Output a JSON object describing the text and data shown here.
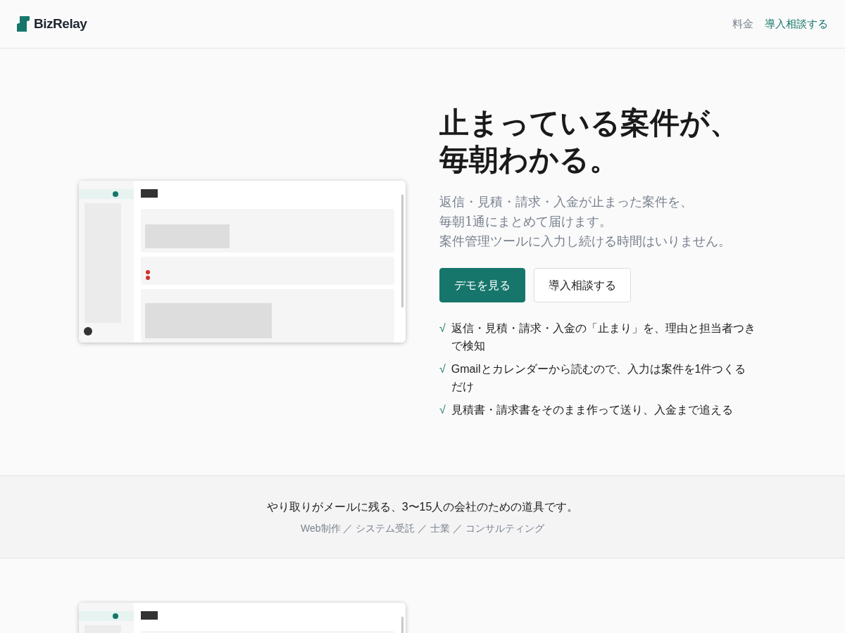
{
  "header": {
    "brand": "BizRelay",
    "nav": [
      {
        "label": "料金",
        "kind": "plain"
      },
      {
        "label": "導入相談する",
        "kind": "accent"
      }
    ]
  },
  "hero": {
    "preview": {
      "kind": "picture"
    },
    "title_lines": [
      "止まっている案件が、",
      "毎朝わかる。"
    ],
    "subtitle_lines": [
      "返信・見積・請求・入金が止まった案件を、",
      "毎朝1通にまとめて届けます。",
      "案件管理ツールに入力し続ける時間はいりません。"
    ],
    "buttons": [
      {
        "label": "デモを見る",
        "kind": "primary"
      },
      {
        "label": "導入相談する",
        "kind": "secondary"
      }
    ],
    "features": [
      {
        "mark": "√",
        "text": "返信・見積・請求・入金の「止まり」を、理由と担当者つきで検知"
      },
      {
        "mark": "√",
        "text": "Gmailとカレンダーから読むので、入力は案件を1件つくるだけ"
      },
      {
        "mark": "√",
        "text": "見積書・請求書をそのまま作って送り、入金まで追える"
      }
    ]
  },
  "audience": {
    "headline": "やり取りがメールに残る、3〜15人の会社のための道具です。",
    "industries": "Web制作 ／ システム受託 ／ 士業 ／ コンサルティング"
  },
  "preview": {
    "kind": "picture"
  }
}
